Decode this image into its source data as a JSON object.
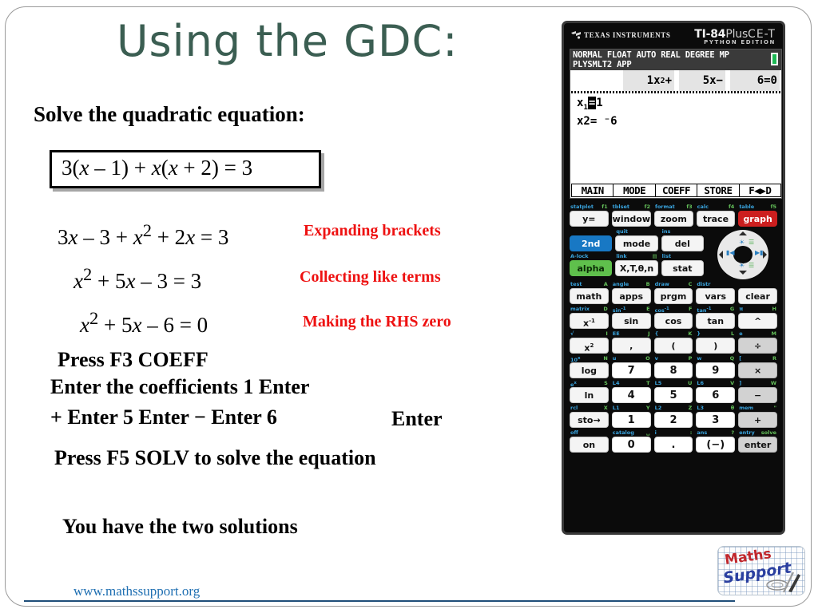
{
  "slide": {
    "title": "Using the GDC:",
    "title_color": "#3b5e52",
    "solve_prompt": "Solve the quadratic equation:",
    "boxed_equation": "3(x – 1) + x(x + 2) = 3",
    "working": [
      "3x – 3 + x2 + 2x = 3",
      "x2 + 5x – 3 = 3",
      "x2 + 5x – 6 = 0"
    ],
    "annotations": [
      "Expanding brackets",
      "Collecting like terms",
      "Making the RHS zero"
    ],
    "annotation_color": "#ee1111",
    "instructions": {
      "press_f3": "Press F3 COEFF",
      "enter_coefficients": "Enter the coefficients  1  Enter",
      "key_sequence": "+ Enter  5 Enter  −  Enter  6",
      "final_enter": "Enter",
      "press_f5": "Press F5 SOLV to solve the equation",
      "two_solutions": "You have the two solutions"
    },
    "footer_url": "www.mathssupport.org",
    "footer_url_color": "#1f6fb2"
  },
  "logo": {
    "line1": "Maths",
    "line2": "Support"
  },
  "calculator": {
    "brand": "TEXAS INSTRUMENTS",
    "model": "TI-84",
    "model_plus": "Plus",
    "model_cet": "CE-T",
    "edition": "PYTHON EDITION",
    "screen": {
      "status_line1": "NORMAL FLOAT AUTO REAL DEGREE MP",
      "status_line2": "PLYSMLT2 APP",
      "equation_cells": [
        "1x2+",
        "5x−",
        "6=0"
      ],
      "solution1_label": "x1",
      "solution1_eq": "=",
      "solution1_value": "1",
      "solution2": "x2= ⁻6",
      "fmenu": [
        "MAIN",
        "MODE",
        "COEFF",
        "STORE",
        "F◀▶D"
      ]
    },
    "keypad": {
      "row_fkeys": {
        "labels_2nd": [
          "statplot",
          "tblset",
          "format",
          "calc",
          "table"
        ],
        "labels_alpha": [
          "f1",
          "f2",
          "f3",
          "f4",
          "f5"
        ],
        "keys": [
          "y=",
          "window",
          "zoom",
          "trace",
          "graph"
        ]
      },
      "row_2nd": {
        "labels_2nd": [
          "",
          "quit",
          "ins"
        ],
        "keys": [
          "2nd",
          "mode",
          "del"
        ]
      },
      "row_alpha": {
        "labels_2nd": [
          "A-lock",
          "link",
          "list"
        ],
        "labels_alpha": [
          "",
          "▤",
          ""
        ],
        "keys": [
          "alpha",
          "X,T,θ,n",
          "stat"
        ]
      },
      "row_math": {
        "labels_2nd": [
          "test",
          "angle",
          "draw",
          "distr",
          ""
        ],
        "labels_alpha": [
          "A",
          "B",
          "C",
          "",
          ""
        ],
        "keys": [
          "math",
          "apps",
          "prgm",
          "vars",
          "clear"
        ]
      },
      "row_trig": {
        "labels_2nd": [
          "matrix",
          "sin-1",
          "cos-1",
          "tan-1",
          "π"
        ],
        "labels_alpha": [
          "D",
          "E",
          "F",
          "G",
          "H"
        ],
        "keys": [
          "x-1",
          "sin",
          "cos",
          "tan",
          "^"
        ]
      },
      "row_sq": {
        "labels_2nd": [
          "√",
          "EE",
          "{",
          "}",
          "e"
        ],
        "labels_alpha": [
          "I",
          "J",
          "K",
          "L",
          "M"
        ],
        "keys": [
          "x2",
          ",",
          "(",
          ")",
          "÷"
        ]
      },
      "row_789": {
        "labels_2nd": [
          "10x",
          "u",
          "v",
          "w",
          "["
        ],
        "labels_alpha": [
          "N",
          "O",
          "P",
          "Q",
          "R"
        ],
        "keys": [
          "log",
          "7",
          "8",
          "9",
          "×"
        ]
      },
      "row_456": {
        "labels_2nd": [
          "ex",
          "L4",
          "L5",
          "L6",
          "]"
        ],
        "labels_alpha": [
          "S",
          "T",
          "U",
          "V",
          "W"
        ],
        "keys": [
          "ln",
          "4",
          "5",
          "6",
          "−"
        ]
      },
      "row_123": {
        "labels_2nd": [
          "rcl",
          "L1",
          "L2",
          "L3",
          "mem"
        ],
        "labels_alpha": [
          "X",
          "Y",
          "Z",
          "θ",
          "\""
        ],
        "keys": [
          "sto→",
          "1",
          "2",
          "3",
          "+"
        ]
      },
      "row_0": {
        "labels_2nd": [
          "off",
          "catalog",
          "i",
          "ans",
          "entry"
        ],
        "labels_alpha": [
          "",
          "␣",
          ":",
          "?",
          "solve"
        ],
        "keys": [
          "on",
          "0",
          ".",
          "(−)",
          "enter"
        ]
      }
    }
  }
}
